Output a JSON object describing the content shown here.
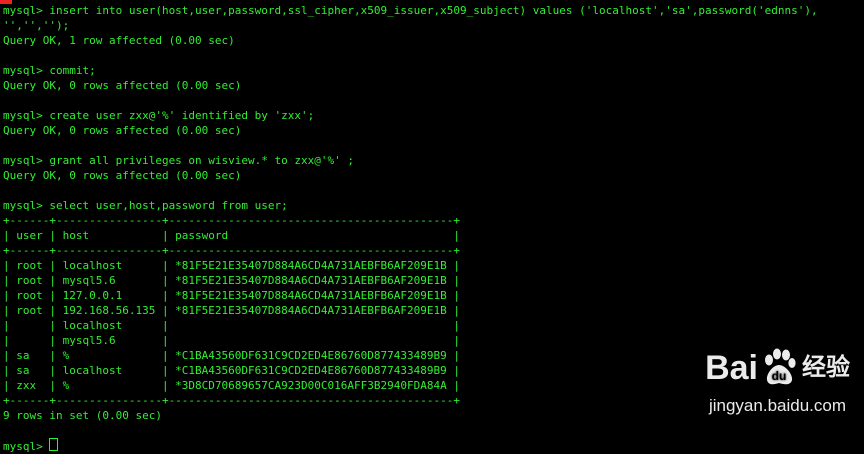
{
  "terminal": {
    "lines": [
      "mysql> insert into user(host,user,password,ssl_cipher,x509_issuer,x509_subject) values ('localhost','sa',password('ednns'),",
      "'','','');",
      "Query OK, 1 row affected (0.00 sec)",
      "",
      "mysql> commit;",
      "Query OK, 0 rows affected (0.00 sec)",
      "",
      "mysql> create user zxx@'%' identified by 'zxx';",
      "Query OK, 0 rows affected (0.00 sec)",
      "",
      "mysql> grant all privileges on wisview.* to zxx@'%' ;",
      "Query OK, 0 rows affected (0.00 sec)",
      "",
      "mysql> select user,host,password from user;",
      "+------+----------------+-------------------------------------------+",
      "| user | host           | password                                  |",
      "+------+----------------+-------------------------------------------+",
      "| root | localhost      | *81F5E21E35407D884A6CD4A731AEBFB6AF209E1B |",
      "| root | mysql5.6       | *81F5E21E35407D884A6CD4A731AEBFB6AF209E1B |",
      "| root | 127.0.0.1      | *81F5E21E35407D884A6CD4A731AEBFB6AF209E1B |",
      "| root | 192.168.56.135 | *81F5E21E35407D884A6CD4A731AEBFB6AF209E1B |",
      "|      | localhost      |                                           |",
      "|      | mysql5.6       |                                           |",
      "| sa   | %              | *C1BA43560DF631C9CD2ED4E86760D877433489B9 |",
      "| sa   | localhost      | *C1BA43560DF631C9CD2ED4E86760D877433489B9 |",
      "| zxx  | %              | *3D8CD70689657CA923D00C016AFF3B2940FDA84A |",
      "+------+----------------+-------------------------------------------+",
      "9 rows in set (0.00 sec)",
      "",
      "mysql> "
    ]
  },
  "watermark": {
    "brand_left": "Bai",
    "brand_right": "du",
    "brand_cn": "经验",
    "url": "jingyan.baidu.com",
    "icon": "baidu-paw-icon"
  },
  "colors": {
    "background": "#000000",
    "text": "#33ee33",
    "cursor_top": "#ee2222"
  }
}
